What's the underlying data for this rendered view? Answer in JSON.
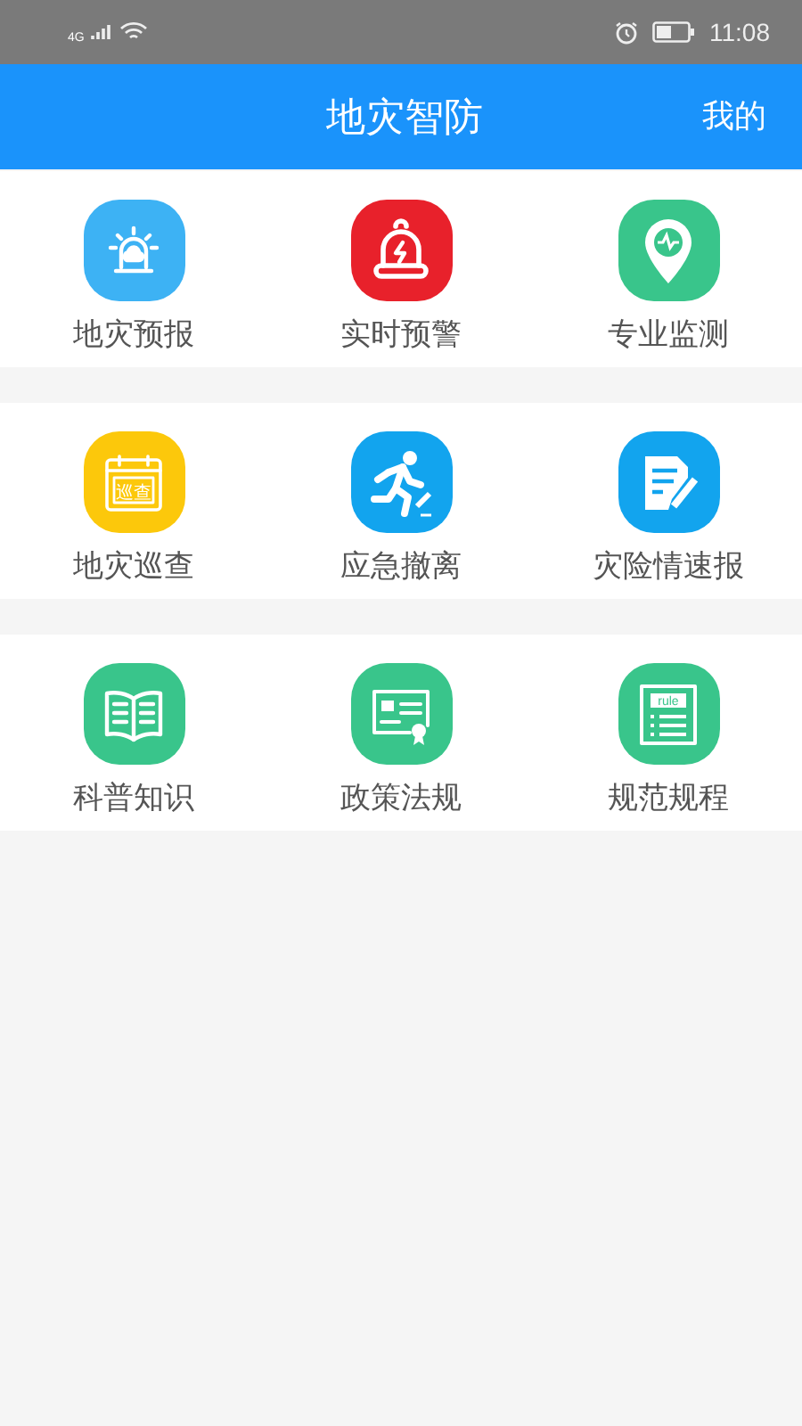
{
  "status_bar": {
    "network": "4G",
    "time": "11:08"
  },
  "header": {
    "title": "地灾智防",
    "action": "我的"
  },
  "sections": [
    {
      "items": [
        {
          "label": "地灾预报",
          "kind": "siren",
          "color": "#3db2f4"
        },
        {
          "label": "实时预警",
          "kind": "bell",
          "color": "#e8212b"
        },
        {
          "label": "专业监测",
          "kind": "pin",
          "color": "#39c58b"
        }
      ]
    },
    {
      "items": [
        {
          "label": "地灾巡查",
          "kind": "calendar",
          "color": "#fcc80b",
          "icon_text": "巡查"
        },
        {
          "label": "应急撤离",
          "kind": "runner",
          "color": "#12a4ee"
        },
        {
          "label": "灾险情速报",
          "kind": "note",
          "color": "#12a4ee"
        }
      ]
    },
    {
      "items": [
        {
          "label": "科普知识",
          "kind": "book",
          "color": "#39c58b"
        },
        {
          "label": "政策法规",
          "kind": "certificate",
          "color": "#39c58b"
        },
        {
          "label": "规范规程",
          "kind": "rules",
          "color": "#39c58b",
          "icon_text": "rule"
        }
      ]
    }
  ]
}
